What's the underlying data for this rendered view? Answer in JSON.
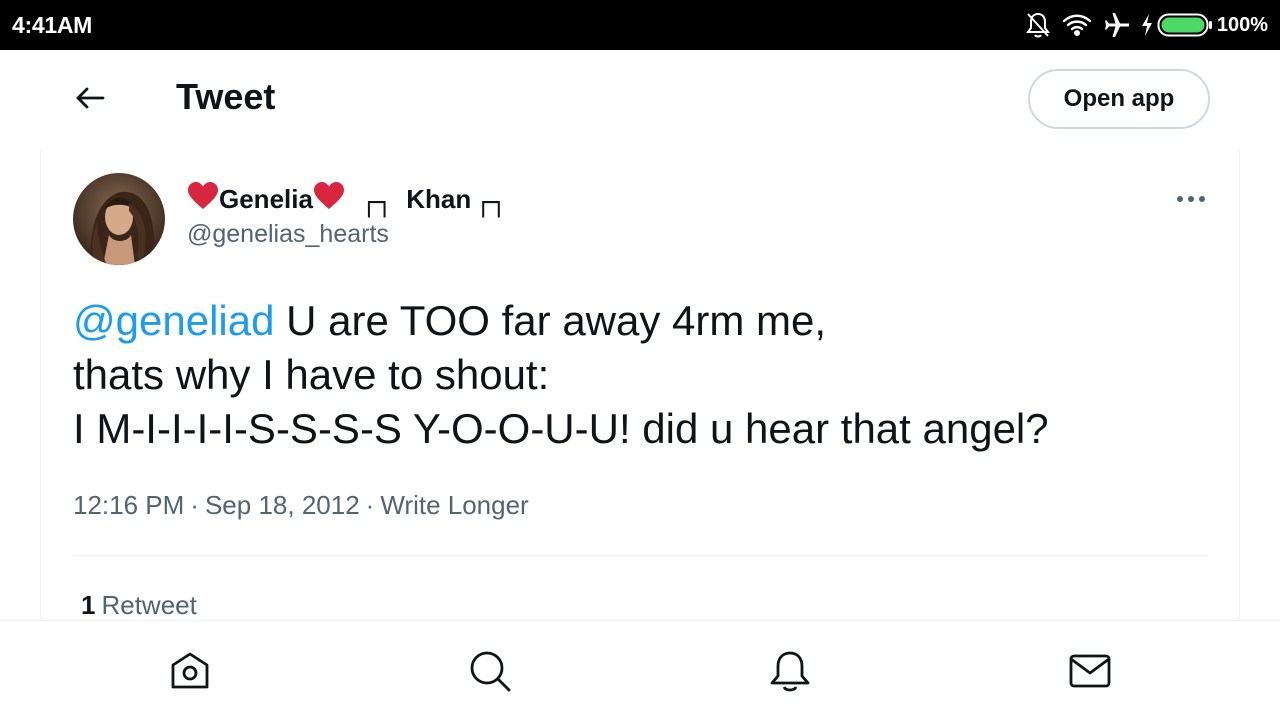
{
  "status_bar": {
    "time": "4:41AM",
    "battery_percent": "100%",
    "icons": [
      "notifications-off-icon",
      "wifi-icon",
      "airplane-icon",
      "charging-bolt-icon",
      "battery-icon"
    ],
    "battery_color": "#4cd964"
  },
  "header": {
    "back_icon": "arrow-left-icon",
    "title": "Tweet",
    "open_app_label": "Open app"
  },
  "tweet": {
    "author": {
      "name_part1": "Genelia",
      "name_glyph": "┌┐",
      "name_part2": "Khan",
      "name_glyph_end": "┌┐",
      "handle": "@genelias_hearts"
    },
    "text": {
      "mention": "@geneliad",
      "line1_rest": " U are TOO far away 4rm me,",
      "line2": "thats why I have to shout:",
      "line3": "I M-I-I-I-I-S-S-S-S Y-O-O-U-U! did u hear that angel?"
    },
    "time": "12:16 PM",
    "date": "Sep 18, 2012",
    "source": "Write Longer",
    "separator": "·",
    "retweet_count": "1",
    "retweet_label": "Retweet"
  },
  "bottom_nav": {
    "items": [
      "home-icon",
      "search-icon",
      "notifications-icon",
      "messages-icon"
    ]
  },
  "colors": {
    "accent": "#1d9bf0",
    "heart": "#d7263d",
    "text_primary": "#0f1419",
    "text_secondary": "#536471"
  }
}
